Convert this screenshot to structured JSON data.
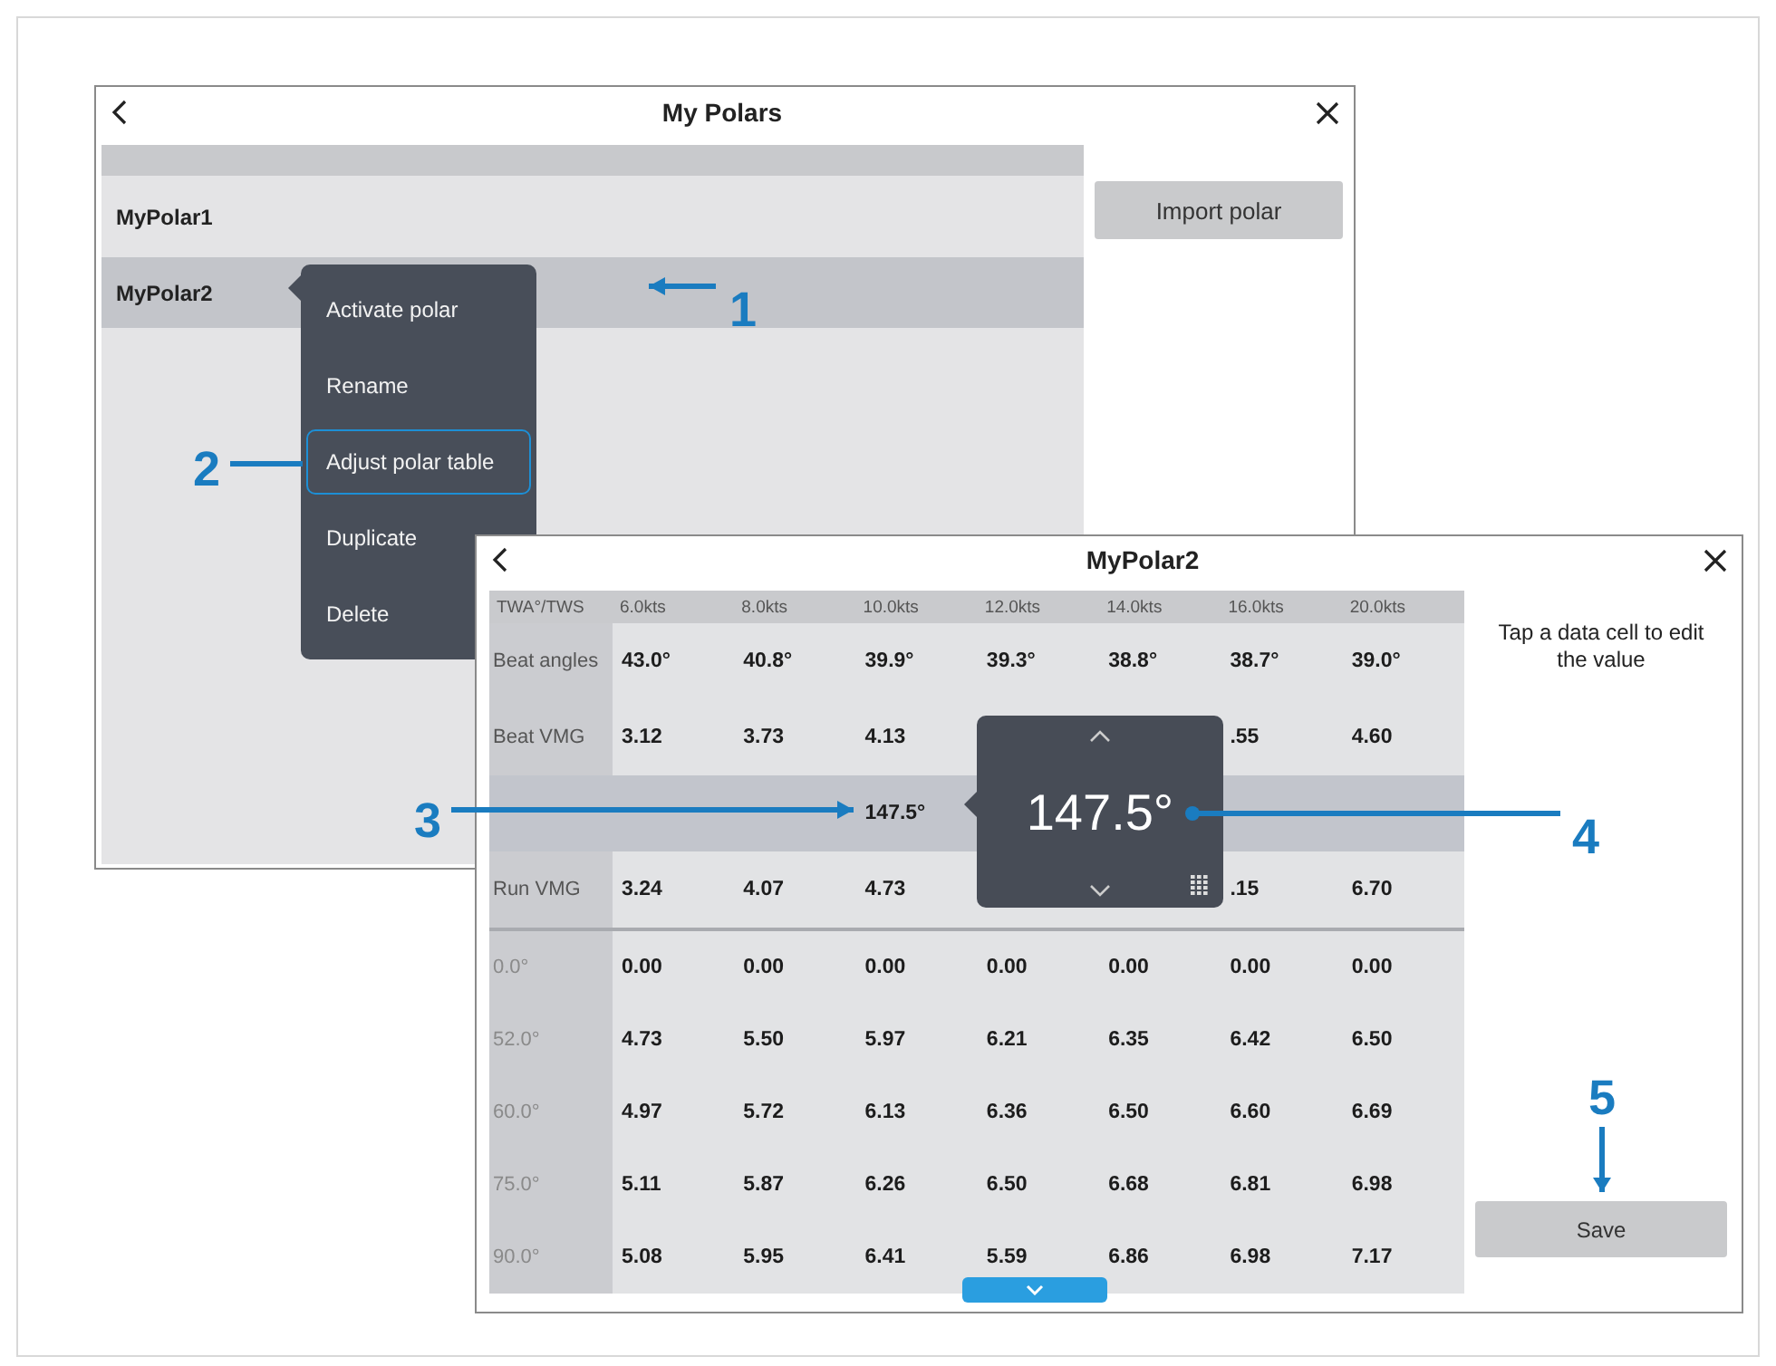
{
  "list_window": {
    "title": "My Polars",
    "polars": [
      {
        "name": "MyPolar1",
        "selected": false
      },
      {
        "name": "MyPolar2",
        "selected": true
      }
    ],
    "import_button": "Import polar",
    "context_menu": [
      {
        "label": "Activate polar",
        "selected": false
      },
      {
        "label": "Rename",
        "selected": false
      },
      {
        "label": "Adjust polar table",
        "selected": true
      },
      {
        "label": "Duplicate",
        "selected": false
      },
      {
        "label": "Delete",
        "selected": false
      }
    ]
  },
  "table_window": {
    "title": "MyPolar2",
    "corner_header": "TWA°/TWS",
    "columns": [
      "6.0kts",
      "8.0kts",
      "10.0kts",
      "12.0kts",
      "14.0kts",
      "16.0kts",
      "20.0kts"
    ],
    "rows": [
      {
        "kind": "summary",
        "label": "Beat angles",
        "selected": false,
        "cells": [
          "43.0°",
          "40.8°",
          "39.9°",
          "39.3°",
          "38.8°",
          "38.7°",
          "39.0°"
        ]
      },
      {
        "kind": "summary",
        "label": "Beat VMG",
        "selected": false,
        "cells": [
          "3.12",
          "3.73",
          "4.13",
          null,
          null,
          ".55",
          "4.60"
        ]
      },
      {
        "kind": "summary",
        "label": null,
        "selected": true,
        "cells": [
          null,
          null,
          "147.5°",
          null,
          null,
          null,
          null
        ]
      },
      {
        "kind": "summary",
        "label": "Run VMG",
        "selected": false,
        "cells": [
          "3.24",
          "4.07",
          "4.73",
          null,
          null,
          ".15",
          "6.70"
        ]
      },
      {
        "kind": "angle",
        "label": "0.0°",
        "selected": false,
        "cells": [
          "0.00",
          "0.00",
          "0.00",
          "0.00",
          "0.00",
          "0.00",
          "0.00"
        ]
      },
      {
        "kind": "angle",
        "label": "52.0°",
        "selected": false,
        "cells": [
          "4.73",
          "5.50",
          "5.97",
          "6.21",
          "6.35",
          "6.42",
          "6.50"
        ]
      },
      {
        "kind": "angle",
        "label": "60.0°",
        "selected": false,
        "cells": [
          "4.97",
          "5.72",
          "6.13",
          "6.36",
          "6.50",
          "6.60",
          "6.69"
        ]
      },
      {
        "kind": "angle",
        "label": "75.0°",
        "selected": false,
        "cells": [
          "5.11",
          "5.87",
          "6.26",
          "6.50",
          "6.68",
          "6.81",
          "6.98"
        ]
      },
      {
        "kind": "angle",
        "label": "90.0°",
        "selected": false,
        "cells": [
          "5.08",
          "5.95",
          "6.41",
          "5.59",
          "6.86",
          "6.98",
          "7.17"
        ]
      }
    ],
    "editor": {
      "value": "147.5°"
    },
    "hint": "Tap a data cell to edit the value",
    "save_button": "Save"
  },
  "callouts": [
    {
      "label": "1"
    },
    {
      "label": "2"
    },
    {
      "label": "3"
    },
    {
      "label": "4"
    },
    {
      "label": "5"
    }
  ]
}
